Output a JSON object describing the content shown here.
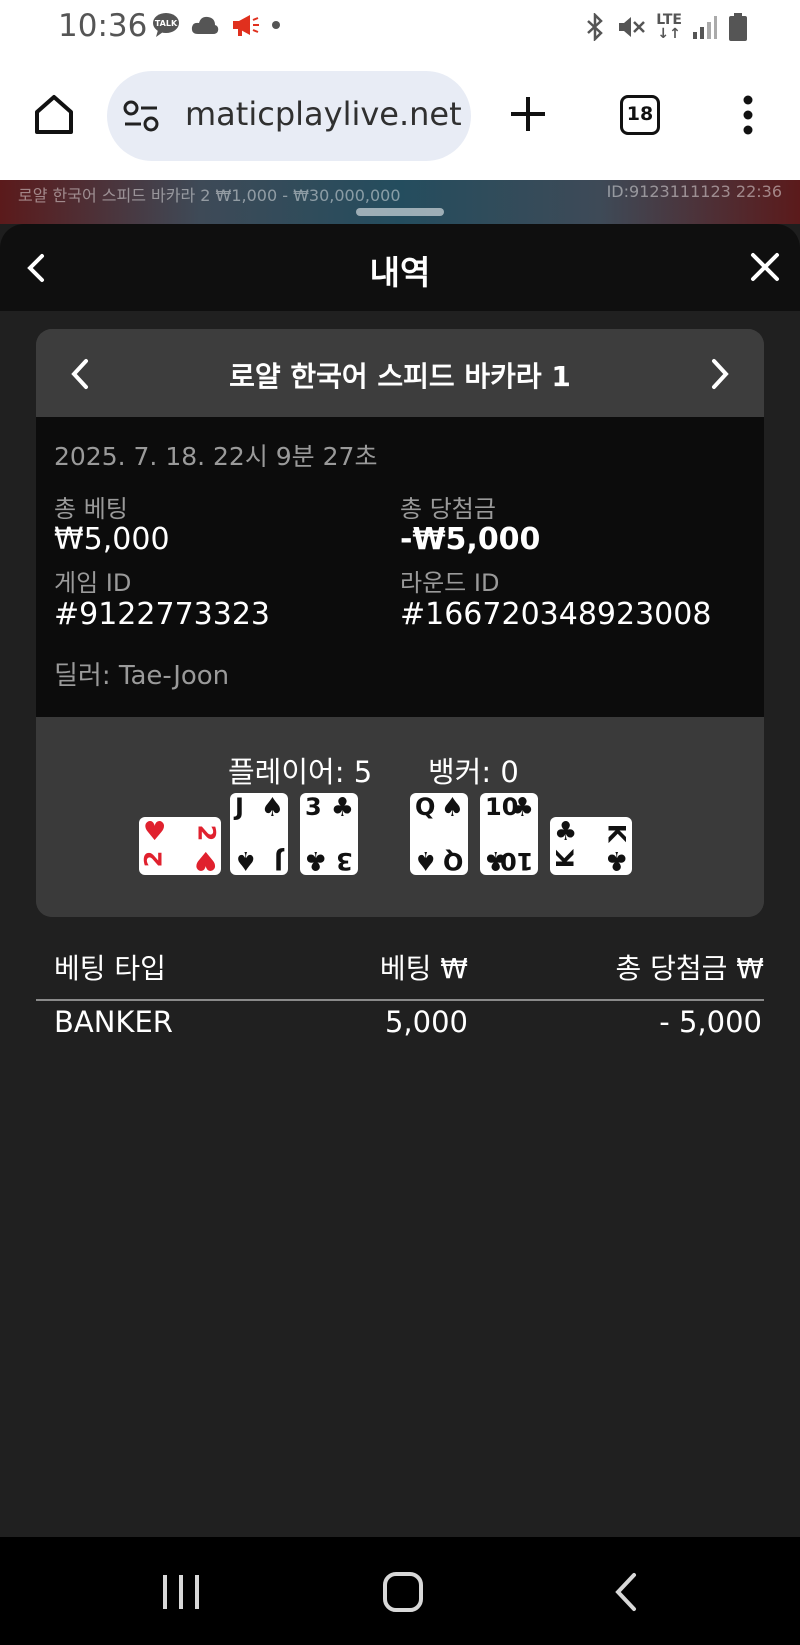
{
  "status_bar": {
    "time": "10:36",
    "icons": [
      "talk-icon",
      "cloud-icon",
      "megaphone-icon",
      "dot-icon",
      "bluetooth-icon",
      "mute-icon",
      "lte-icon",
      "signal-icon",
      "battery-icon"
    ],
    "network_label": "LTE"
  },
  "browser": {
    "url": "maticplaylive.net",
    "tab_count": "18",
    "icons": [
      "home-icon",
      "site-settings-icon",
      "new-tab-icon",
      "tabs-icon",
      "more-icon"
    ]
  },
  "game_strip": {
    "table_info": "로얄 한국어 스피드 바카라 2  ₩1,000 - ₩30,000,000",
    "id_info": "ID:9123111123  22:36"
  },
  "panel": {
    "title": "내역",
    "back_icon": "chevron-left-icon",
    "close_icon": "close-icon"
  },
  "game": {
    "title": "로얄 한국어 스피드 바카라 1",
    "datetime": "2025. 7. 18. 22시 9분 27초",
    "total_bet_label": "총 베팅",
    "total_bet_value": "₩5,000",
    "total_win_label": "총 당첨금",
    "total_win_value": "-₩5,000",
    "game_id_label": "게임 ID",
    "game_id_value": "#9122773323",
    "round_id_label": "라운드 ID",
    "round_id_value": "#166720348923008",
    "dealer": "딜러: Tae-Joon"
  },
  "hands": {
    "player_label": "플레이어: 5",
    "banker_label": "뱅커: 0",
    "player_cards": [
      {
        "rank": "2",
        "suit": "♥",
        "color": "#e0212e",
        "sideways": true
      },
      {
        "rank": "J",
        "suit": "♠",
        "color": "#111111",
        "sideways": false
      },
      {
        "rank": "3",
        "suit": "♣",
        "color": "#111111",
        "sideways": false
      }
    ],
    "banker_cards": [
      {
        "rank": "Q",
        "suit": "♠",
        "color": "#111111",
        "sideways": false
      },
      {
        "rank": "10",
        "suit": "♣",
        "color": "#111111",
        "sideways": false
      },
      {
        "rank": "K",
        "suit": "♣",
        "color": "#111111",
        "sideways": true
      }
    ]
  },
  "bets_table": {
    "headers": [
      "베팅 타입",
      "베팅 ₩",
      "총 당첨금 ₩"
    ],
    "rows": [
      {
        "type": "BANKER",
        "bet": "5,000",
        "win": "- 5,000"
      }
    ]
  },
  "nav_bar": {
    "icons": [
      "recents-icon",
      "home-nav-icon",
      "back-nav-icon"
    ]
  }
}
